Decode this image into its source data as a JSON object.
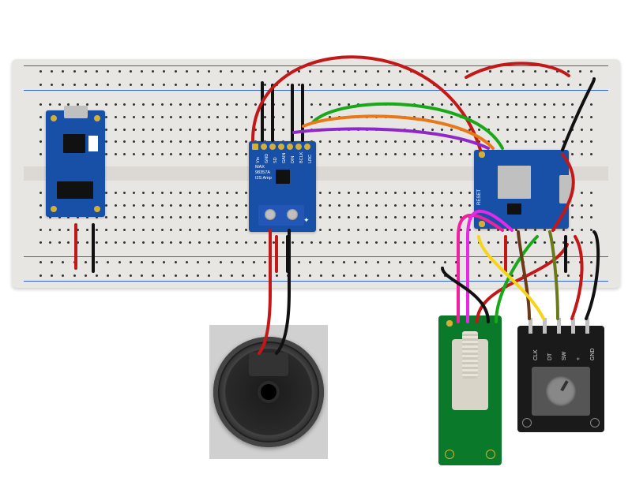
{
  "components": {
    "breadboard": {
      "type": "full-size solderless breadboard"
    },
    "usb_module": {
      "type": "USB/LiPo charger breakout",
      "connector": "micro-USB"
    },
    "amplifier": {
      "type": "I2S Class-D Amp",
      "chip_label_line1": "MAX",
      "chip_label_line2": "98357A",
      "chip_label_line3": "I2S Amp",
      "pins": [
        "Vin",
        "GND",
        "SD",
        "GAIN",
        "DIN",
        "BCLK",
        "LRC"
      ],
      "output": "screw terminal to speaker"
    },
    "mcu": {
      "type": "Wemos D1 mini style dev board",
      "connector": "micro-USB",
      "side_label": "RESET"
    },
    "speaker": {
      "type": "small round loudspeaker"
    },
    "slide_pot": {
      "type": "slide potentiometer breakout",
      "pins": 5
    },
    "rotary_encoder": {
      "type": "KY-040 rotary encoder module",
      "pins": [
        "CLK",
        "DT",
        "SW",
        "+",
        "GND"
      ]
    }
  },
  "wire_colors": {
    "power": "#c21818",
    "ground": "#111111",
    "sig_green": "#18a818",
    "sig_orange": "#e87818",
    "sig_purple": "#9028c8",
    "sig_pink": "#e828e8",
    "sig_magenta": "#f020a0",
    "sig_yellow": "#f5d518",
    "sig_brown": "#6a3a1a",
    "sig_olive": "#6a7a1a"
  }
}
